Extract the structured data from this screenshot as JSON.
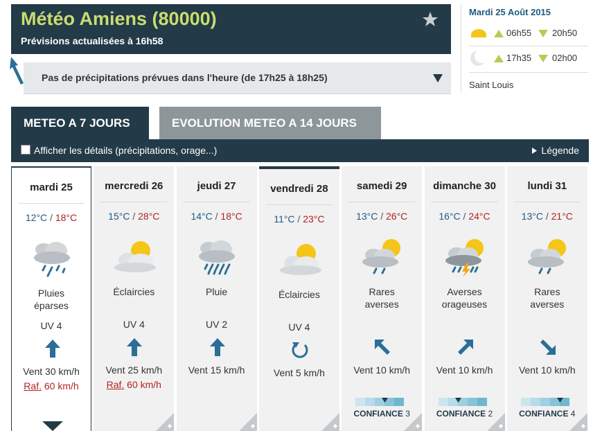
{
  "header": {
    "title": "Météo Amiens (80000)",
    "subtitle": "Prévisions actualisées à 16h58",
    "favorite_icon": "star-icon"
  },
  "precip": {
    "text": "Pas de précipitations prévues dans l'heure (de 17h25 à 18h25)"
  },
  "sunmoon": {
    "date": "Mardi 25 Août 2015",
    "sun_rise": "06h55",
    "sun_set": "20h50",
    "moon_rise": "17h35",
    "moon_set": "02h00",
    "saint": "Saint Louis"
  },
  "tabs": {
    "active": "METEO A 7 JOURS",
    "inactive": "EVOLUTION METEO A 14 JOURS"
  },
  "details": {
    "checkbox_label": "Afficher les détails (précipitations, orage...)",
    "legend": "Légende"
  },
  "colors": {
    "primary": "#233a48",
    "accent_title": "#c8de6f",
    "temp_min": "#1f5a82",
    "temp_max": "#b22222"
  },
  "days": [
    {
      "name": "mardi 25",
      "tmin": "12°C",
      "tmax": "18°C",
      "icon": "showers-cloud-icon",
      "desc1": "Pluies",
      "desc2": "éparses",
      "uv": "UV 4",
      "wind_dir": "north",
      "wind": "Vent 30 km/h",
      "gust_label": "Raf.",
      "gust": "60 km/h",
      "confidence": null
    },
    {
      "name": "mercredi 26",
      "tmin": "15°C",
      "tmax": "28°C",
      "icon": "sun-cloud-icon",
      "desc1": "Éclaircies",
      "desc2": "",
      "uv": "UV 4",
      "wind_dir": "north",
      "wind": "Vent 25 km/h",
      "gust_label": "Raf.",
      "gust": "60 km/h",
      "confidence": null
    },
    {
      "name": "jeudi 27",
      "tmin": "14°C",
      "tmax": "18°C",
      "icon": "rain-cloud-icon",
      "desc1": "Pluie",
      "desc2": "",
      "uv": "UV 2",
      "wind_dir": "north",
      "wind": "Vent 15 km/h",
      "gust_label": "",
      "gust": "",
      "confidence": null
    },
    {
      "name": "vendredi 28",
      "tmin": "11°C",
      "tmax": "23°C",
      "icon": "sun-cloud-icon",
      "desc1": "Éclaircies",
      "desc2": "",
      "uv": "UV 4",
      "wind_dir": "variable",
      "wind": "Vent 5 km/h",
      "gust_label": "",
      "gust": "",
      "confidence": null
    },
    {
      "name": "samedi 29",
      "tmin": "13°C",
      "tmax": "26°C",
      "icon": "sun-showers-icon",
      "desc1": "Rares",
      "desc2": "averses",
      "uv": "",
      "wind_dir": "north-west",
      "wind": "Vent 10 km/h",
      "gust_label": "",
      "gust": "",
      "confidence": "CONFIANCE",
      "confidence_level": "3"
    },
    {
      "name": "dimanche 30",
      "tmin": "16°C",
      "tmax": "24°C",
      "icon": "thunder-showers-icon",
      "desc1": "Averses",
      "desc2": "orageuses",
      "uv": "",
      "wind_dir": "north-east",
      "wind": "Vent 10 km/h",
      "gust_label": "",
      "gust": "",
      "confidence": "CONFIANCE",
      "confidence_level": "2"
    },
    {
      "name": "lundi 31",
      "tmin": "13°C",
      "tmax": "21°C",
      "icon": "sun-showers-icon",
      "desc1": "Rares",
      "desc2": "averses",
      "uv": "",
      "wind_dir": "south-east",
      "wind": "Vent 10 km/h",
      "gust_label": "",
      "gust": "",
      "confidence": "CONFIANCE",
      "confidence_level": "4"
    }
  ]
}
